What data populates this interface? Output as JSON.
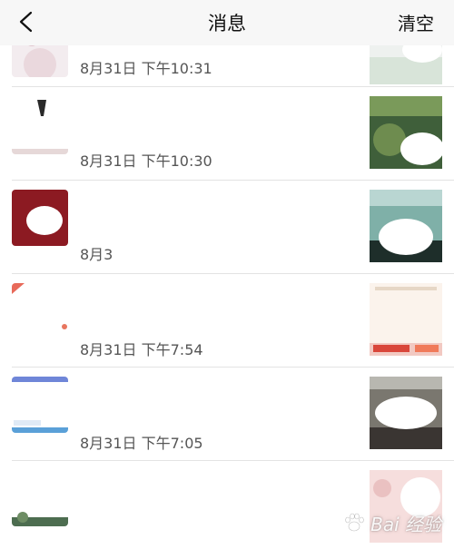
{
  "header": {
    "title": "消息",
    "clear_label": "清空",
    "back_icon": "chevron-left-icon"
  },
  "messages": [
    {
      "name": "",
      "time": "8月31日 下午10:31"
    },
    {
      "name": "",
      "time": "8月31日 下午10:30"
    },
    {
      "name": "",
      "time": "8月3"
    },
    {
      "name": "",
      "time": "8月31日 下午7:54"
    },
    {
      "name": "",
      "time": "8月31日 下午7:05"
    },
    {
      "name": "",
      "time": ""
    }
  ],
  "watermark": {
    "text": "Bai 经验"
  },
  "colors": {
    "nav_bg": "#f7f7f7",
    "separator": "#e3e3e3",
    "text_secondary": "#555555"
  }
}
